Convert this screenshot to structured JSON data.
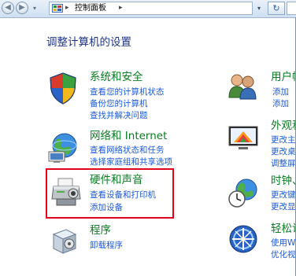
{
  "address_bar": {
    "path": "控制面板",
    "separator": "▸",
    "dropdown": "▾",
    "refresh": "↻"
  },
  "page_title": "调整计算机的设置",
  "left_categories": [
    {
      "name": "system-and-security",
      "icon": "shield-icon",
      "title": "系统和安全",
      "links": [
        "查看您的计算机状态",
        "备份您的计算机",
        "查找并解决问题"
      ]
    },
    {
      "name": "network-and-internet",
      "icon": "globe-network-icon",
      "title": "网络和 Internet",
      "links": [
        "查看网络状态和任务",
        "选择家庭组和共享选项"
      ]
    },
    {
      "name": "hardware-and-sound",
      "icon": "printer-icon",
      "title": "硬件和声音",
      "links": [
        "查看设备和打印机",
        "添加设备"
      ]
    },
    {
      "name": "programs",
      "icon": "programs-icon",
      "title": "程序",
      "links": [
        "卸载程序"
      ]
    }
  ],
  "right_categories": [
    {
      "name": "user-accounts",
      "icon": "users-icon",
      "title": "用户帐",
      "links": [
        "添加",
        "添加"
      ]
    },
    {
      "name": "appearance",
      "icon": "display-icon",
      "title": "外观和",
      "links": [
        "更改主",
        "更改桌",
        "调整屏"
      ]
    },
    {
      "name": "clock",
      "icon": "clock-globe-icon",
      "title": "时钟、",
      "links": [
        "更改键",
        "更改显"
      ]
    },
    {
      "name": "ease-of-access",
      "icon": "ease-of-access-icon",
      "title": "轻松访",
      "links": [
        "使用W",
        "优化视"
      ]
    }
  ],
  "colors": {
    "heading": "#0a7a23",
    "link": "#1a5ad8",
    "title": "#1e3287",
    "highlight": "#e2001a"
  }
}
